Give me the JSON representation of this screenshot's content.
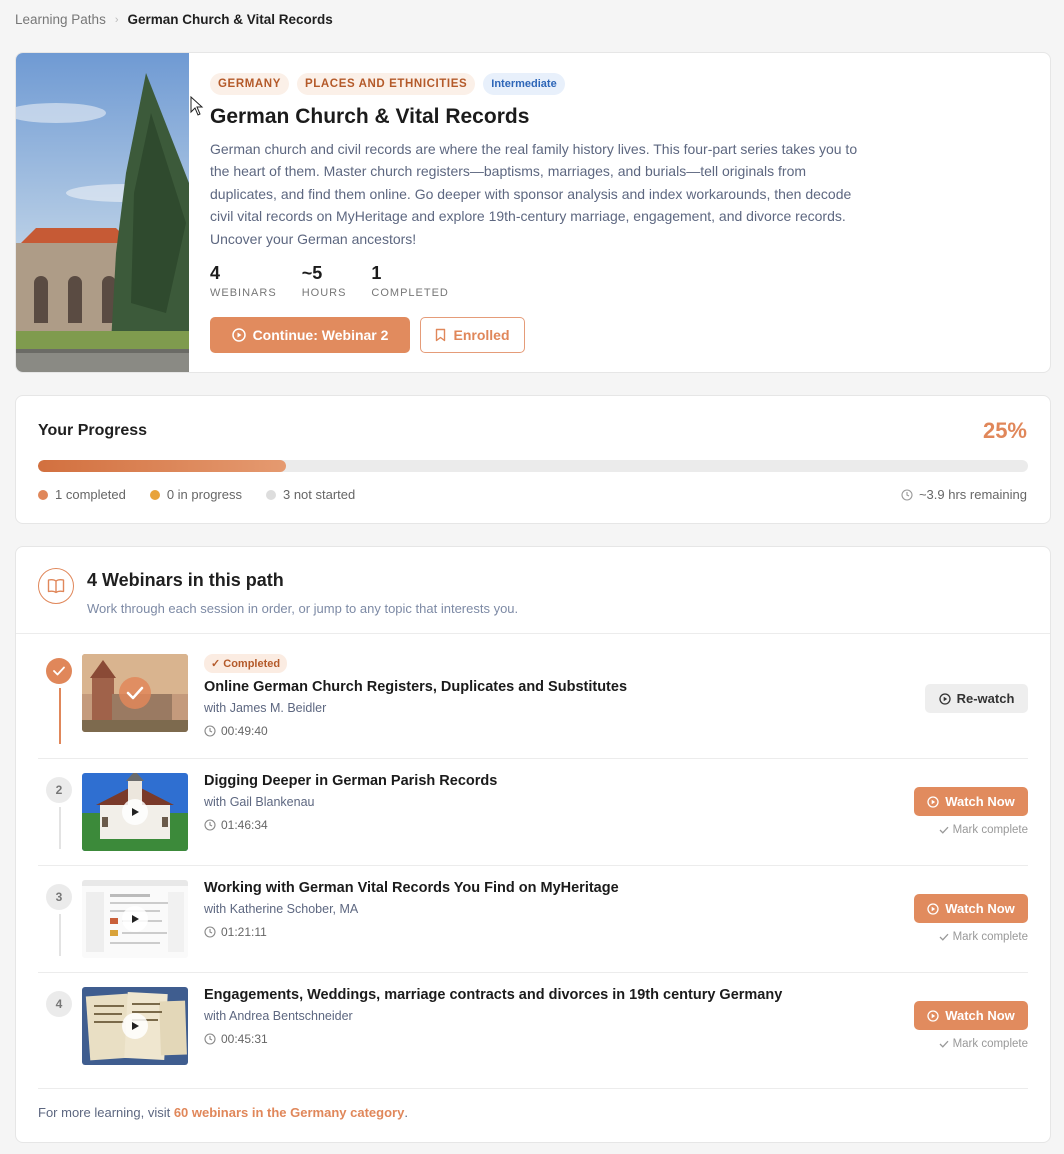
{
  "breadcrumb": {
    "parent": "Learning Paths",
    "separator": "›",
    "current": "German Church & Vital Records"
  },
  "hero": {
    "tags": [
      "GERMANY",
      "PLACES AND ETHNICITIES"
    ],
    "level": "Intermediate",
    "title": "German Church & Vital Records",
    "description": "German church and civil records are where the real family history lives. This four-part series takes you to the heart of them. Master church registers—baptisms, marriages, and burials—tell originals from duplicates, and find them online. Go deeper with sponsor analysis and index workarounds, then decode civil vital records on MyHeritage and explore 19th-century marriage, engagement, and divorce records. Uncover your German ancestors!",
    "stats": [
      {
        "value": "4",
        "label": "WEBINARS"
      },
      {
        "value": "~5",
        "label": "HOURS"
      },
      {
        "value": "1",
        "label": "COMPLETED"
      }
    ],
    "continue_label": "Continue: Webinar 2",
    "enrolled_label": "Enrolled"
  },
  "progress": {
    "title": "Your Progress",
    "percent_label": "25%",
    "percent": 25,
    "completed": "1 completed",
    "in_progress": "0 in progress",
    "not_started": "3 not started",
    "remaining": "~3.9 hrs remaining"
  },
  "webinars": {
    "title": "4 Webinars in this path",
    "subtitle": "Work through each session in order, or jump to any topic that interests you.",
    "items": [
      {
        "step": "1",
        "status": "✓ Completed",
        "title": "Online German Church Registers, Duplicates and Substitutes",
        "presenter": "with James M. Beidler",
        "duration": "00:49:40",
        "action": "Re-watch"
      },
      {
        "step": "2",
        "title": "Digging Deeper in German Parish Records",
        "presenter": "with Gail Blankenau",
        "duration": "01:46:34",
        "action": "Watch Now",
        "mark": "Mark complete"
      },
      {
        "step": "3",
        "title": "Working with German Vital Records You Find on MyHeritage",
        "presenter": "with Katherine Schober, MA",
        "duration": "01:21:11",
        "action": "Watch Now",
        "mark": "Mark complete"
      },
      {
        "step": "4",
        "title": "Engagements, Weddings, marriage contracts and divorces in 19th century Germany",
        "presenter": "with Andrea Bentschneider",
        "duration": "00:45:31",
        "action": "Watch Now",
        "mark": "Mark complete"
      }
    ],
    "footer_text": "For more learning, visit ",
    "footer_link": "60 webinars in the Germany category",
    "footer_end": "."
  },
  "colors": {
    "accent": "#e18b5e",
    "accent_dark": "#d2703f",
    "in_progress": "#e8a33a",
    "not_started": "#dddddd"
  }
}
